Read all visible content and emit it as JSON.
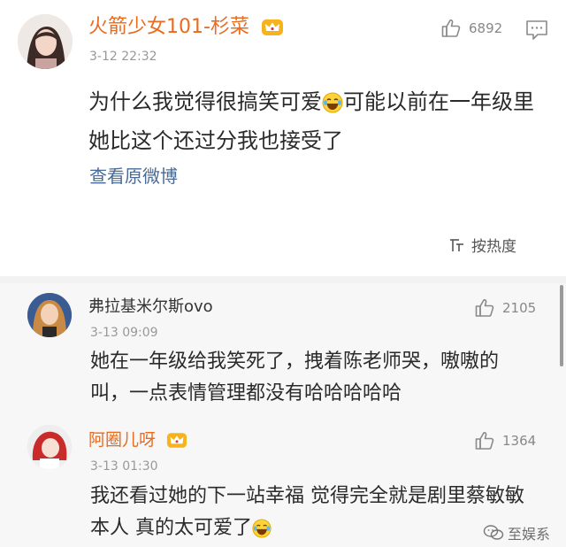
{
  "post": {
    "author": "火箭少女101-杉菜",
    "time": "3-12 22:32",
    "likes": "6892",
    "text_before_emoji": "为什么我觉得很搞笑可爱",
    "text_after_emoji": "可能以前在一年级里她比这个还过分我也接受了",
    "view_original": "查看原微博",
    "sort_label": "按热度"
  },
  "comments": [
    {
      "author": "弗拉基米尔斯ovo",
      "time": "3-13 09:09",
      "likes": "2105",
      "text": "她在一年级给我笑死了，拽着陈老师哭，嗷嗷的叫，一点表情管理都没有哈哈哈哈哈"
    },
    {
      "author": "阿圈儿呀",
      "time": "3-13 01:30",
      "likes": "1364",
      "text_before_emoji": "我还看过她的下一站幸福 觉得完全就是剧里蔡敏敏本人 真的太可爱了"
    }
  ],
  "watermark": "至娱系",
  "colors": {
    "name_vip": "#e86b1f",
    "link": "#4a6b95",
    "time": "#999999",
    "comment_bg": "#f7f7f7"
  },
  "icons": [
    "thumbs-up-icon",
    "comment-icon",
    "crown-icon",
    "laugh-cry-emoji",
    "sort-icon",
    "wechat-icon"
  ]
}
